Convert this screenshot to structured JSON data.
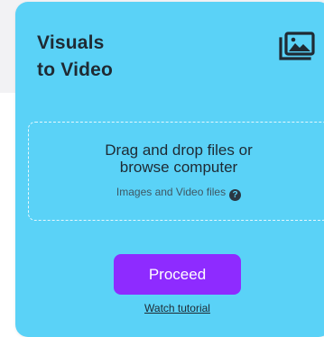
{
  "card": {
    "title_line1": "Visuals",
    "title_line2": "to Video",
    "icon": "image-gallery-icon",
    "accent_color": "#5ad2f7"
  },
  "dropzone": {
    "line1": "Drag and drop files or",
    "line2": "browse computer",
    "subtext": "Images and Video files",
    "help_icon": "question-circle-icon",
    "help_glyph": "?"
  },
  "actions": {
    "proceed_label": "Proceed",
    "proceed_color": "#8e2bff",
    "tutorial_label": "Watch tutorial"
  }
}
